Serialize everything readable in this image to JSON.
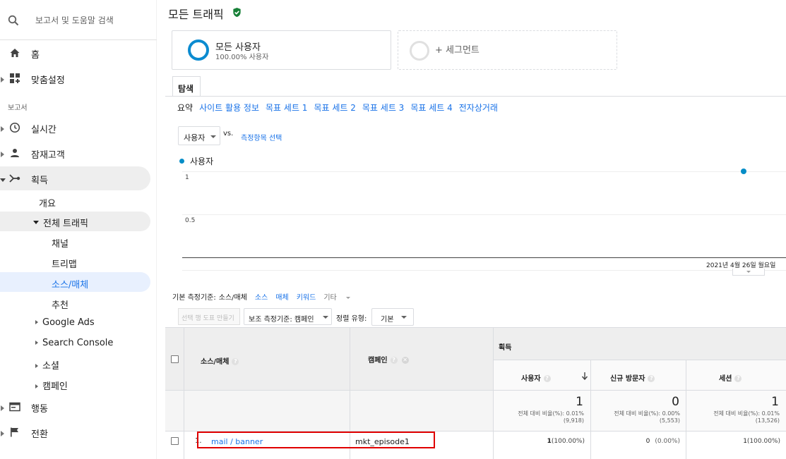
{
  "sidebar": {
    "search_placeholder": "보고서 및 도움말 검색",
    "home": "홈",
    "customization": "맞춤설정",
    "section_reports": "보고서",
    "realtime": "실시간",
    "audience": "잠재고객",
    "acquisition": "획득",
    "overview": "개요",
    "all_traffic": "전체 트래픽",
    "channels": "채널",
    "treemaps": "트리맵",
    "source_medium": "소스/매체",
    "referrals": "추천",
    "google_ads": "Google Ads",
    "search_console": "Search Console",
    "social": "소셜",
    "campaigns": "캠페인",
    "behavior": "행동",
    "conversions": "전환"
  },
  "header": {
    "title": "모든 트래픽"
  },
  "segments": [
    {
      "name": "모든 사용자",
      "sub": "100.00% 사용자"
    },
    {
      "name": "+ 세그먼트"
    }
  ],
  "tabs": {
    "explore": "탐색",
    "sub": [
      "요약",
      "사이트 활용 정보",
      "목표 세트 1",
      "목표 세트 2",
      "목표 세트 3",
      "목표 세트 4",
      "전자상거래"
    ]
  },
  "chart_controls": {
    "metric": "사용자",
    "vs": "vs.",
    "select_metric": "측정항목 선택"
  },
  "chart_data": {
    "type": "line",
    "series": [
      {
        "name": "사용자",
        "values": [
          1
        ]
      }
    ],
    "x": [
      "2021년 4월 26일 월요일"
    ],
    "y_ticks": [
      "1",
      "0.5"
    ],
    "ylim": [
      0,
      1
    ],
    "color": "#058dc7"
  },
  "dimension_bar": {
    "label": "기본 측정기준:",
    "current": "소스/매체",
    "links": [
      "소스",
      "매체",
      "키워드"
    ],
    "more": "기타"
  },
  "table_controls": {
    "create_chart": "선택 행 도표 만들기",
    "secondary_dim": "보조 측정기준: 캠페인",
    "sort_label": "정렬 유형:",
    "sort_value": "기본"
  },
  "table": {
    "group_header": "획득",
    "col_source": "소스/매체",
    "col_campaign": "캠페인",
    "col_users": "사용자",
    "col_new": "신규 방문자",
    "col_sessions": "세션",
    "totals": [
      {
        "value": "1",
        "line1": "전체 대비 비율(%): 0.01%",
        "line2": "(9,918)"
      },
      {
        "value": "0",
        "line1": "전체 대비 비율(%): 0.00%",
        "line2": "(5,553)"
      },
      {
        "value": "1",
        "line1": "전체 대비 비율(%): 0.01%",
        "line2": "(13,526)"
      }
    ],
    "rows": [
      {
        "index": "1.",
        "source": "mail / banner",
        "campaign": "mkt_episode1",
        "users": "1",
        "users_pct": "(100.00%)",
        "new": "0",
        "new_pct": "(0.00%)",
        "sessions": "1",
        "sessions_pct": "(100.00%)"
      }
    ]
  }
}
